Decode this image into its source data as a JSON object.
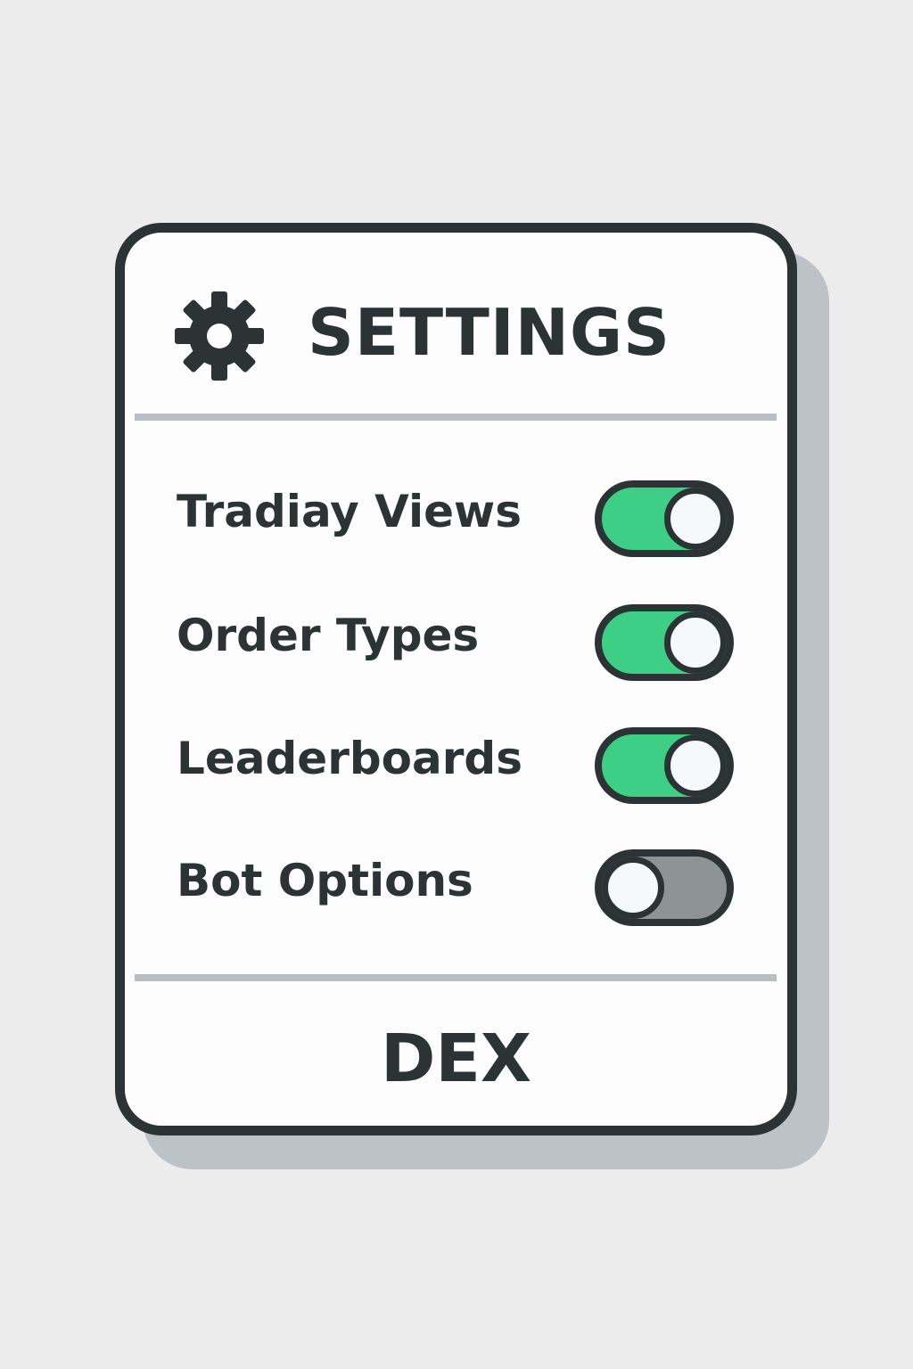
{
  "window": {
    "title": "SETTINGS",
    "icon": "gear-icon"
  },
  "settings": {
    "items": [
      {
        "label": "Tradiay Views",
        "enabled": true
      },
      {
        "label": "Order Types",
        "enabled": true
      },
      {
        "label": "Leaderboards",
        "enabled": true
      },
      {
        "label": "Bot Options",
        "enabled": false
      }
    ]
  },
  "footer": {
    "label": "DEX"
  },
  "colors": {
    "toggle_on": "#3dcf86",
    "toggle_off": "#8e9496",
    "outline": "#2b3335",
    "divider": "#b8bec4",
    "background": "#ececec"
  }
}
